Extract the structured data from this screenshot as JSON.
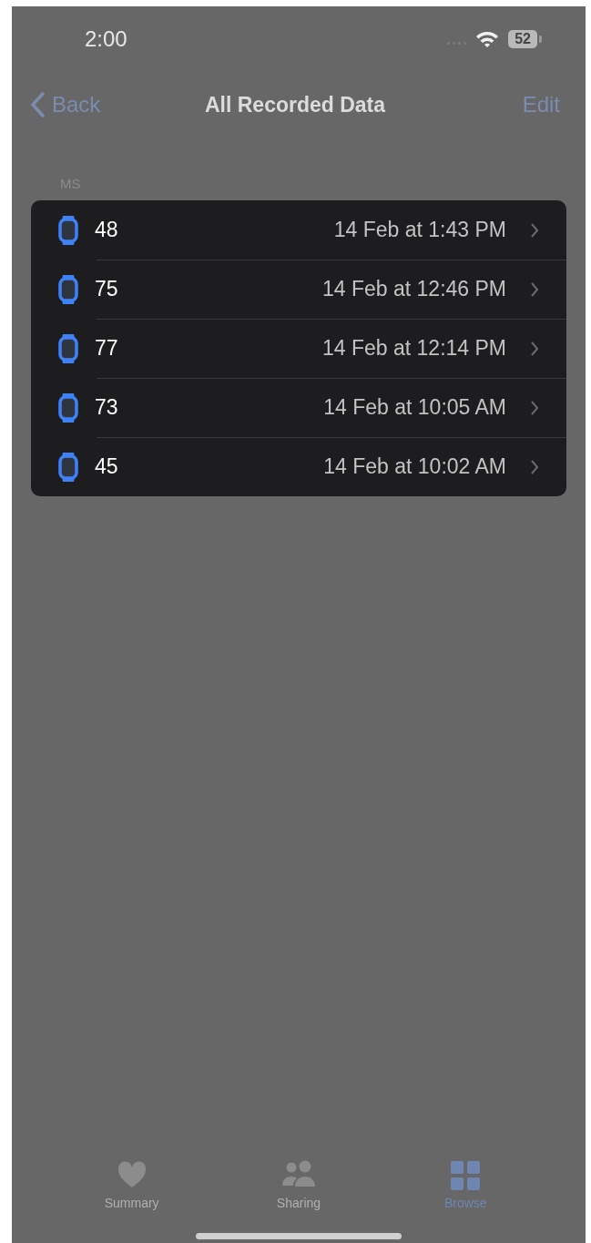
{
  "status_bar": {
    "time": "2:00",
    "battery": "52"
  },
  "nav": {
    "back": "Back",
    "title": "All Recorded Data",
    "edit": "Edit"
  },
  "section": {
    "header": "MS",
    "rows": [
      {
        "value": "48",
        "date": "14 Feb at 1:43 PM"
      },
      {
        "value": "75",
        "date": "14 Feb at 12:46 PM"
      },
      {
        "value": "77",
        "date": "14 Feb at 12:14 PM"
      },
      {
        "value": "73",
        "date": "14 Feb at 10:05 AM"
      },
      {
        "value": "45",
        "date": "14 Feb at 10:02 AM"
      }
    ]
  },
  "tabs": [
    {
      "label": "Summary",
      "kind": "heart",
      "selected": false
    },
    {
      "label": "Sharing",
      "kind": "people",
      "selected": false
    },
    {
      "label": "Browse",
      "kind": "grid",
      "selected": true
    }
  ]
}
